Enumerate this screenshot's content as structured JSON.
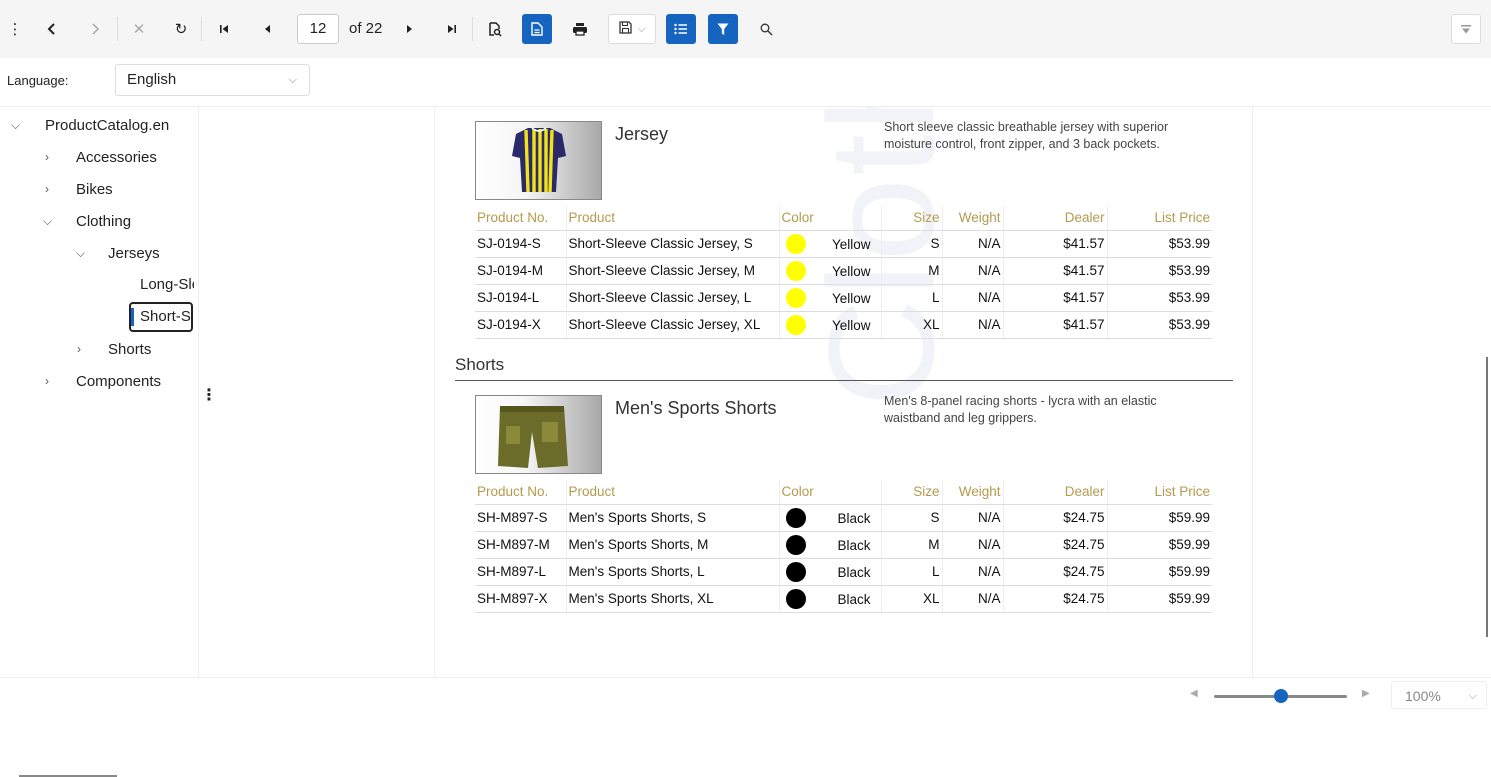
{
  "toolbar": {
    "page_current": "12",
    "page_of": "of 22",
    "icons": [
      "more-vert-icon",
      "back-icon",
      "forward-icon",
      "stop-icon",
      "refresh-icon",
      "first-page-icon",
      "prev-page-icon",
      "next-page-icon",
      "last-page-icon",
      "search-document-icon",
      "page-view-icon",
      "print-icon",
      "save-icon",
      "toc-icon",
      "filter-icon",
      "search-icon",
      "collapse-icon"
    ]
  },
  "language": {
    "label": "Language:",
    "value": "English"
  },
  "tree": {
    "root": "ProductCatalog.en",
    "items": [
      "Accessories",
      "Bikes",
      "Clothing",
      "Jerseys",
      "Long-Sle",
      "Short-Sle",
      "Shorts",
      "Components"
    ]
  },
  "report": {
    "watermark": "Cloth",
    "columns": [
      "Product No.",
      "Product",
      "Color",
      "Size",
      "Weight",
      "Dealer",
      "List Price"
    ],
    "jersey": {
      "title": "Jersey",
      "description": "Short sleeve classic breathable jersey with superior moisture control, front zipper, and 3 back pockets.",
      "rows": [
        {
          "no": "SJ-0194-S",
          "product": "Short-Sleeve Classic Jersey, S",
          "color": "Yellow",
          "size": "S",
          "weight": "N/A",
          "dealer": "$41.57",
          "list": "$53.99"
        },
        {
          "no": "SJ-0194-M",
          "product": "Short-Sleeve Classic Jersey, M",
          "color": "Yellow",
          "size": "M",
          "weight": "N/A",
          "dealer": "$41.57",
          "list": "$53.99"
        },
        {
          "no": "SJ-0194-L",
          "product": "Short-Sleeve Classic Jersey, L",
          "color": "Yellow",
          "size": "L",
          "weight": "N/A",
          "dealer": "$41.57",
          "list": "$53.99"
        },
        {
          "no": "SJ-0194-X",
          "product": "Short-Sleeve Classic Jersey, XL",
          "color": "Yellow",
          "size": "XL",
          "weight": "N/A",
          "dealer": "$41.57",
          "list": "$53.99"
        }
      ]
    },
    "shorts_section": "Shorts",
    "shorts": {
      "title": "Men's Sports Shorts",
      "description": "Men's 8-panel racing shorts - lycra with an elastic waistband and leg grippers.",
      "rows": [
        {
          "no": "SH-M897-S",
          "product": "Men's Sports Shorts, S",
          "color": "Black",
          "size": "S",
          "weight": "N/A",
          "dealer": "$24.75",
          "list": "$59.99"
        },
        {
          "no": "SH-M897-M",
          "product": "Men's Sports Shorts, M",
          "color": "Black",
          "size": "M",
          "weight": "N/A",
          "dealer": "$24.75",
          "list": "$59.99"
        },
        {
          "no": "SH-M897-L",
          "product": "Men's Sports Shorts, L",
          "color": "Black",
          "size": "L",
          "weight": "N/A",
          "dealer": "$24.75",
          "list": "$59.99"
        },
        {
          "no": "SH-M897-X",
          "product": "Men's Sports Shorts, XL",
          "color": "Black",
          "size": "XL",
          "weight": "N/A",
          "dealer": "$24.75",
          "list": "$59.99"
        }
      ]
    }
  },
  "zoom": {
    "value": "100%",
    "slider_fraction": 0.45
  },
  "colors": {
    "accent": "#1565c0",
    "header_text": "#b59a4e",
    "yellow": "#ffff00",
    "black": "#000000"
  }
}
